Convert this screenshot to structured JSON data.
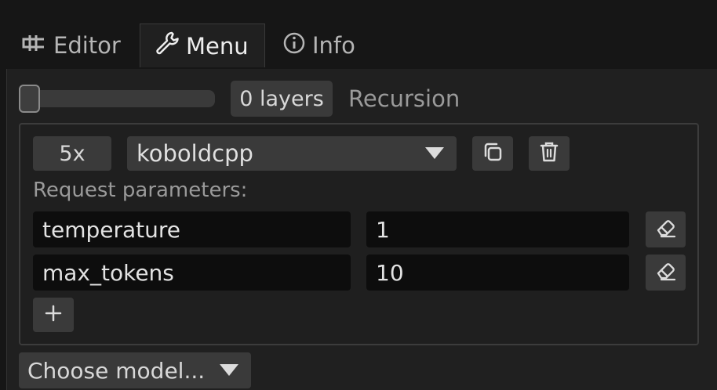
{
  "tabs": [
    {
      "label": "Editor",
      "icon": "editor-icon",
      "active": false
    },
    {
      "label": "Menu",
      "icon": "wrench-icon",
      "active": true
    },
    {
      "label": "Info",
      "icon": "info-icon",
      "active": false
    }
  ],
  "recursion": {
    "slider_value": 0,
    "layers_label": "0 layers",
    "label": "Recursion"
  },
  "model_entry": {
    "count": "5x",
    "model": "koboldcpp",
    "params_label": "Request parameters:",
    "params": [
      {
        "key": "temperature",
        "value": "1"
      },
      {
        "key": "max_tokens",
        "value": "10"
      }
    ],
    "add_label": "+"
  },
  "choose_model": {
    "label": "Choose model..."
  },
  "colors": {
    "background": "#161616",
    "panel": "#202020",
    "control": "#3a3a3a",
    "field": "#0d0d0d",
    "text": "#d8d8d8",
    "muted": "#9a9a9a"
  }
}
